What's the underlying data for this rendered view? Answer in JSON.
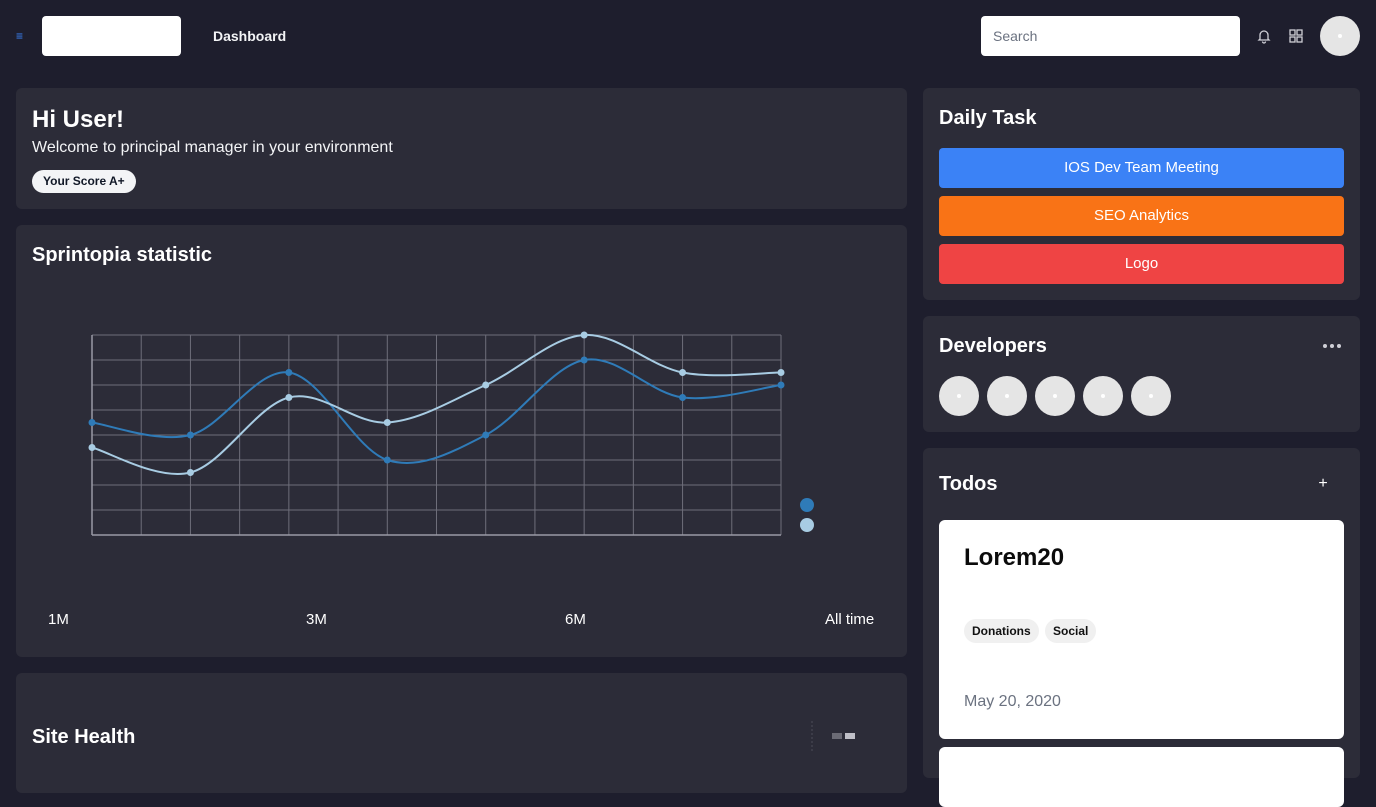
{
  "header": {
    "title": "Dashboard",
    "search": {
      "placeholder": "Search",
      "value": ""
    },
    "icons": [
      "menu-icon",
      "bell-icon",
      "grid-icon"
    ]
  },
  "welcome": {
    "greeting": "Hi User!",
    "message": "Welcome to principal manager in your environment",
    "score_badge": "Your Score A+"
  },
  "stats": {
    "title": "Sprintopia statistic",
    "ranges": [
      "1M",
      "3M",
      "6M",
      "All time"
    ]
  },
  "site_health": {
    "title": "Site Health"
  },
  "daily_task": {
    "title": "Daily Task",
    "tasks": [
      {
        "label": "IOS Dev Team Meeting",
        "color": "#3b82f6"
      },
      {
        "label": "SEO Analytics",
        "color": "#f97316"
      },
      {
        "label": "Logo",
        "color": "#ef4444"
      }
    ]
  },
  "developers": {
    "title": "Developers",
    "count": 5
  },
  "todos": {
    "title": "Todos",
    "add_label": "+",
    "items": [
      {
        "title": "Lorem20",
        "tags": [
          "Donations",
          "Social"
        ],
        "date": "May 20, 2020"
      }
    ]
  },
  "colors": {
    "background": "#1e1e2d",
    "card": "#2c2c38",
    "series_dark": "#2f7bb8",
    "series_light": "#a8cce3"
  },
  "chart_data": {
    "type": "line",
    "x": [
      0,
      1,
      2,
      3,
      4,
      5,
      6,
      7
    ],
    "ylim": [
      0,
      8
    ],
    "grid": true,
    "legend": "right",
    "series": [
      {
        "values": [
          4.5,
          4,
          6.5,
          3,
          4,
          7,
          5.5,
          6
        ]
      },
      {
        "values": [
          3.5,
          2.5,
          5.5,
          4.5,
          6,
          8,
          6.5,
          6.5
        ]
      }
    ]
  }
}
